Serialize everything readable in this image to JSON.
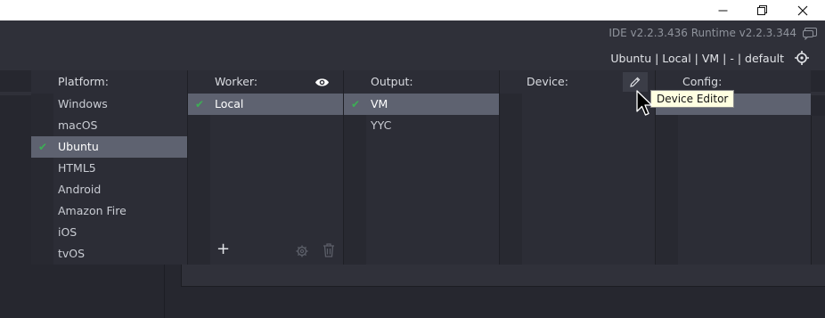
{
  "window_controls": {
    "minimize": "—",
    "restore": "❐",
    "close": "✕"
  },
  "appbar": {
    "version_text": "IDE v2.2.3.436  Runtime v2.2.3.344",
    "target_summary": "Ubuntu | Local | VM | - | default"
  },
  "platform": {
    "title": "Platform:",
    "items": [
      {
        "label": "Windows",
        "selected": false
      },
      {
        "label": "macOS",
        "selected": false
      },
      {
        "label": "Ubuntu",
        "selected": true
      },
      {
        "label": "HTML5",
        "selected": false
      },
      {
        "label": "Android",
        "selected": false
      },
      {
        "label": "Amazon Fire",
        "selected": false
      },
      {
        "label": "iOS",
        "selected": false
      },
      {
        "label": "tvOS",
        "selected": false
      }
    ]
  },
  "worker": {
    "title": "Worker:",
    "items": [
      {
        "label": "Local",
        "selected": true
      }
    ],
    "add_symbol": "+"
  },
  "output": {
    "title": "Output:",
    "items": [
      {
        "label": "VM",
        "selected": true
      },
      {
        "label": "YYC",
        "selected": false
      }
    ]
  },
  "device": {
    "title": "Device:",
    "tooltip": "Device Editor"
  },
  "config": {
    "title": "Config:"
  },
  "check_mark": "✔",
  "colors": {
    "selected_row": "#5e6270",
    "check": "#3dae55",
    "tooltip_bg": "#ffffe1"
  }
}
